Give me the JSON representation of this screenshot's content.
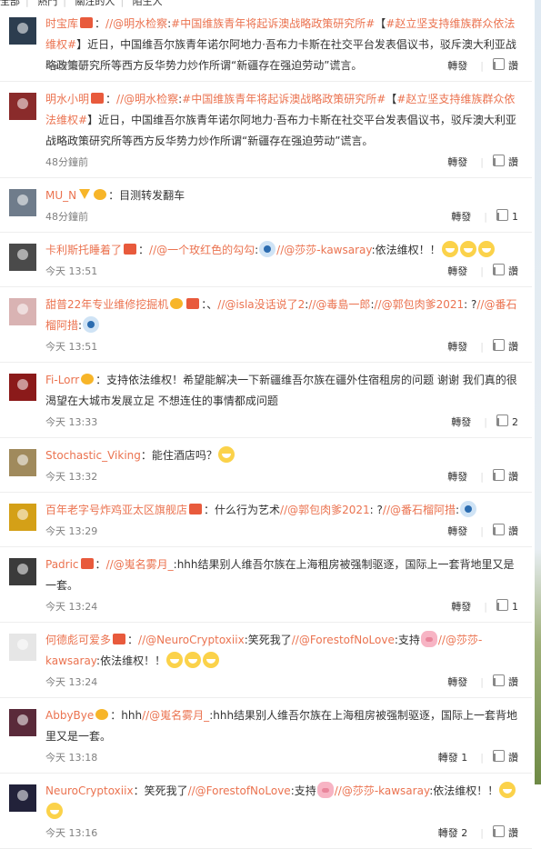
{
  "tabs": [
    "全部",
    "熱門",
    "關注的人",
    "陌生人"
  ],
  "comments": [
    {
      "avatar_color": "#2c3d4f",
      "user": "时宝库",
      "badges": [
        "red"
      ],
      "parts": [
        {
          "t": "text",
          "v": "："
        },
        {
          "t": "mention",
          "v": "//@明水检察"
        },
        {
          "t": "text",
          "v": ":"
        },
        {
          "t": "topic",
          "v": "#中国维族青年将起诉澳战略政策研究所#"
        },
        {
          "t": "text",
          "v": "【"
        },
        {
          "t": "topic",
          "v": "#赵立坚支持维族群众依法维权#"
        },
        {
          "t": "text",
          "v": "】近日，中国维吾尔族青年诺尔阿地力·吾布力卡斯在社交平台发表倡议书，驳斥澳大利亚战略政策研究所等西方反华势力炒作所谓“新疆存在强迫劳动”谎言。"
        }
      ],
      "time": "46分鐘前",
      "repost": "轉發",
      "like": "讚",
      "body_height": 46
    },
    {
      "avatar_color": "#8a2b2b",
      "user": "明水小明",
      "badges": [
        "red"
      ],
      "parts": [
        {
          "t": "text",
          "v": "："
        },
        {
          "t": "mention",
          "v": "//@明水检察"
        },
        {
          "t": "text",
          "v": ":"
        },
        {
          "t": "topic",
          "v": "#中国维族青年将起诉澳战略政策研究所#"
        },
        {
          "t": "text",
          "v": "【"
        },
        {
          "t": "topic",
          "v": "#赵立坚支持维族群众依法维权#"
        },
        {
          "t": "text",
          "v": "】近日，中国维吾尔族青年诺尔阿地力·吾布力卡斯在社交平台发表倡议书，驳斥澳大利亚战略政策研究所等西方反华势力炒作所谓“新疆存在强迫劳动”谎言。"
        }
      ],
      "time": "48分鐘前",
      "repost": "轉發",
      "like": "讚",
      "body_height": 69
    },
    {
      "avatar_color": "#6f7c8b",
      "user": "MU_N",
      "badges": [
        "v",
        "gold"
      ],
      "parts": [
        {
          "t": "text",
          "v": "：目测转发翻车"
        }
      ],
      "time": "48分鐘前",
      "repost": "轉發",
      "like": "1",
      "body_height": 23
    },
    {
      "avatar_color": "#4a4a4a",
      "user": "卡利斯托睡着了",
      "badges": [
        "red"
      ],
      "parts": [
        {
          "t": "text",
          "v": "："
        },
        {
          "t": "mention",
          "v": "//@一个玫红色的勾勾"
        },
        {
          "t": "text",
          "v": ":"
        },
        {
          "t": "emoji",
          "v": "face"
        },
        {
          "t": "mention",
          "v": "//@莎莎-kawsaray"
        },
        {
          "t": "text",
          "v": ":依法维权！！"
        },
        {
          "t": "emoji",
          "v": "grin"
        },
        {
          "t": "emoji",
          "v": "grin"
        },
        {
          "t": "emoji",
          "v": "grin"
        }
      ],
      "time": "今天 13:51",
      "repost": "轉發",
      "like": "讚",
      "body_height": 23
    },
    {
      "avatar_color": "#d9b3b3",
      "user": "甜普22年专业维修挖掘机",
      "badges": [
        "gold",
        "red"
      ],
      "parts": [
        {
          "t": "text",
          "v": "：、"
        },
        {
          "t": "mention",
          "v": "//@isla没话说了2"
        },
        {
          "t": "text",
          "v": ":"
        },
        {
          "t": "mention",
          "v": "//@毒島一郎"
        },
        {
          "t": "text",
          "v": ":"
        },
        {
          "t": "mention",
          "v": "//@郭包肉爹2021"
        },
        {
          "t": "text",
          "v": ": ?"
        },
        {
          "t": "mention",
          "v": "//@番石榴阿措"
        },
        {
          "t": "text",
          "v": ":"
        },
        {
          "t": "emoji",
          "v": "face"
        }
      ],
      "time": "今天 13:51",
      "repost": "轉發",
      "like": "讚",
      "body_height": 46
    },
    {
      "avatar_color": "#8b1a1a",
      "user": "Fi-Lorr",
      "badges": [
        "gold"
      ],
      "parts": [
        {
          "t": "text",
          "v": "：支持依法维权！希望能解决一下新疆维吾尔族在疆外住宿租房的问题 谢谢 我们真的很渴望在大城市发展立足  不想连住的事情都成问题"
        }
      ],
      "time": "今天 13:33",
      "repost": "轉發",
      "like": "2",
      "body_height": 46
    },
    {
      "avatar_color": "#a08a5c",
      "user": "Stochastic_Viking",
      "badges": [],
      "parts": [
        {
          "t": "text",
          "v": "：能住酒店吗？"
        },
        {
          "t": "emoji",
          "v": "grin"
        }
      ],
      "time": "今天 13:32",
      "repost": "轉發",
      "like": "讚",
      "body_height": 23
    },
    {
      "avatar_color": "#d4a017",
      "user": "百年老字号炸鸡亚太区旗舰店",
      "badges": [
        "red"
      ],
      "parts": [
        {
          "t": "text",
          "v": "：什么行为艺术"
        },
        {
          "t": "mention",
          "v": "//@郭包肉爹2021"
        },
        {
          "t": "text",
          "v": ": ?"
        },
        {
          "t": "mention",
          "v": "//@番石榴阿措"
        },
        {
          "t": "text",
          "v": ":"
        },
        {
          "t": "emoji",
          "v": "face"
        }
      ],
      "time": "今天 13:29",
      "repost": "轉發",
      "like": "讚",
      "body_height": 23
    },
    {
      "avatar_color": "#3b3b3b",
      "user": "Padric",
      "badges": [
        "red"
      ],
      "parts": [
        {
          "t": "text",
          "v": "："
        },
        {
          "t": "mention",
          "v": "//@嵬名雾月_"
        },
        {
          "t": "text",
          "v": ":hhh结果别人维吾尔族在上海租房被强制驱逐，国际上一套背地里又是一套。"
        }
      ],
      "time": "今天 13:24",
      "repost": "轉發",
      "like": "1",
      "body_height": 46
    },
    {
      "avatar_color": "#e6e6e6",
      "user": "何德彪可爱多",
      "badges": [
        "red"
      ],
      "parts": [
        {
          "t": "text",
          "v": "："
        },
        {
          "t": "mention",
          "v": "//@NeuroCryptoxiix"
        },
        {
          "t": "text",
          "v": ":笑死我了"
        },
        {
          "t": "mention",
          "v": "//@ForestofNoLove"
        },
        {
          "t": "text",
          "v": ":支持"
        },
        {
          "t": "emoji",
          "v": "pig"
        },
        {
          "t": "mention",
          "v": "//@莎莎-kawsaray"
        },
        {
          "t": "text",
          "v": ":依法维权！！"
        },
        {
          "t": "emoji",
          "v": "grin"
        },
        {
          "t": "emoji",
          "v": "grin"
        },
        {
          "t": "emoji",
          "v": "grin"
        }
      ],
      "time": "今天 13:24",
      "repost": "轉發",
      "like": "讚",
      "body_height": 46
    },
    {
      "avatar_color": "#5a2a3a",
      "user": "AbbyBye",
      "badges": [
        "gold"
      ],
      "parts": [
        {
          "t": "text",
          "v": "：hhh"
        },
        {
          "t": "mention",
          "v": "//@嵬名雾月_"
        },
        {
          "t": "text",
          "v": ":hhh结果别人维吾尔族在上海租房被强制驱逐，国际上一套背地里又是一套。"
        }
      ],
      "time": "今天 13:18",
      "repost": "轉發 1",
      "like": "讚",
      "body_height": 46
    },
    {
      "avatar_color": "#22223a",
      "user": "NeuroCryptoxiix",
      "badges": [],
      "parts": [
        {
          "t": "text",
          "v": "：笑死我了"
        },
        {
          "t": "mention",
          "v": "//@ForestofNoLove"
        },
        {
          "t": "text",
          "v": ":支持"
        },
        {
          "t": "emoji",
          "v": "pig"
        },
        {
          "t": "mention",
          "v": "//@莎莎-kawsaray"
        },
        {
          "t": "text",
          "v": ":依法维权！！"
        },
        {
          "t": "emoji",
          "v": "grin"
        },
        {
          "t": "emoji",
          "v": "grin"
        }
      ],
      "time": "今天 13:16",
      "repost": "轉發 2",
      "like": "讚",
      "body_height": 46
    }
  ]
}
